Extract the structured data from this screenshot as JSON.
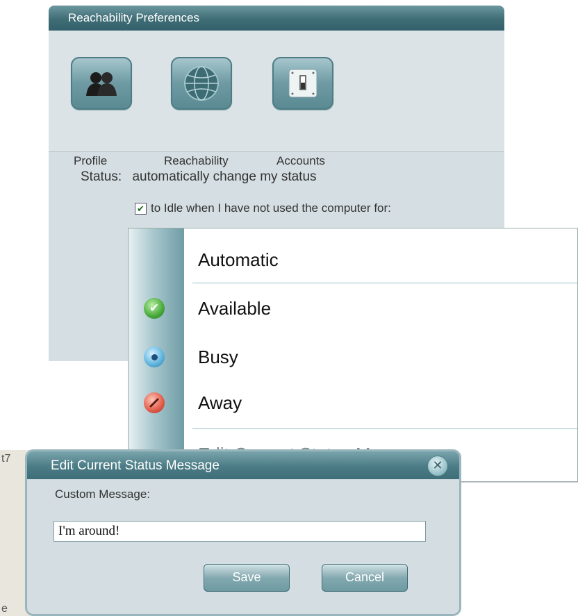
{
  "prefs": {
    "title": "Reachability Preferences",
    "toolbar": [
      {
        "label": "Profile",
        "icon": "profile-icon"
      },
      {
        "label": "Reachability",
        "icon": "globe-icon"
      },
      {
        "label": "Accounts",
        "icon": "toggle-switch-icon"
      }
    ],
    "status_label": "Status:",
    "status_text": "automatically change my status",
    "idle_label": "to Idle when I have not used the computer for:",
    "idle_checked": true
  },
  "menu": {
    "items": [
      {
        "label": "Automatic",
        "icon": ""
      },
      {
        "label": "Available",
        "icon": "available-check-icon",
        "color": "#46a83a"
      },
      {
        "label": "Busy",
        "icon": "busy-dot-icon",
        "color": "#5cb2dc"
      },
      {
        "label": "Away",
        "icon": "away-slash-icon",
        "color": "#e05a48"
      }
    ],
    "edit_item": "Edit Current Status Message..."
  },
  "background_window": {
    "title_fragment": "t7",
    "text_fragment": "e"
  },
  "dialog": {
    "title": "Edit Current Status Message",
    "label": "Custom Message:",
    "value": "I'm around!",
    "save": "Save",
    "cancel": "Cancel"
  }
}
